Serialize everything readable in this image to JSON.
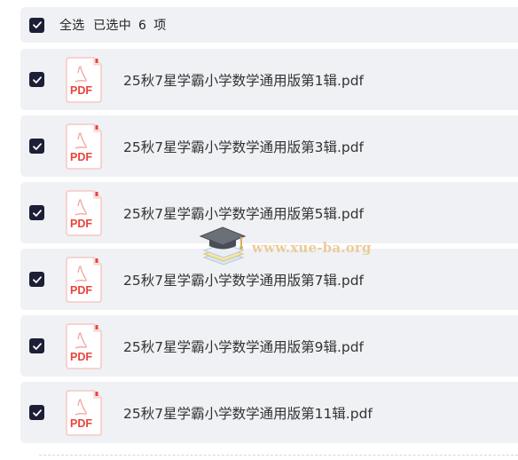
{
  "header": {
    "select_all_label": "全选",
    "selected_prefix": "已选中",
    "selected_count": "6",
    "selected_suffix": "项",
    "all_checked": true
  },
  "files": [
    {
      "name": "25秋7星学霸小学数学通用版第1辑.pdf",
      "checked": true,
      "icon_label": "PDF"
    },
    {
      "name": "25秋7星学霸小学数学通用版第3辑.pdf",
      "checked": true,
      "icon_label": "PDF"
    },
    {
      "name": "25秋7星学霸小学数学通用版第5辑.pdf",
      "checked": true,
      "icon_label": "PDF"
    },
    {
      "name": "25秋7星学霸小学数学通用版第7辑.pdf",
      "checked": true,
      "icon_label": "PDF"
    },
    {
      "name": "25秋7星学霸小学数学通用版第9辑.pdf",
      "checked": true,
      "icon_label": "PDF"
    },
    {
      "name": "25秋7星学霸小学数学通用版第11辑.pdf",
      "checked": true,
      "icon_label": "PDF"
    }
  ],
  "watermark": {
    "text": "www.xue-ba.org",
    "icon": "graduation-cap-books-icon"
  },
  "icons": {
    "checkbox": "checkmark-icon",
    "file": "pdf-file-icon"
  },
  "colors": {
    "row_background": "#f0f1f4",
    "checkbox_fill": "#1c1f36",
    "pdf_red": "#e8453c",
    "watermark_gold": "#e8c48a"
  }
}
